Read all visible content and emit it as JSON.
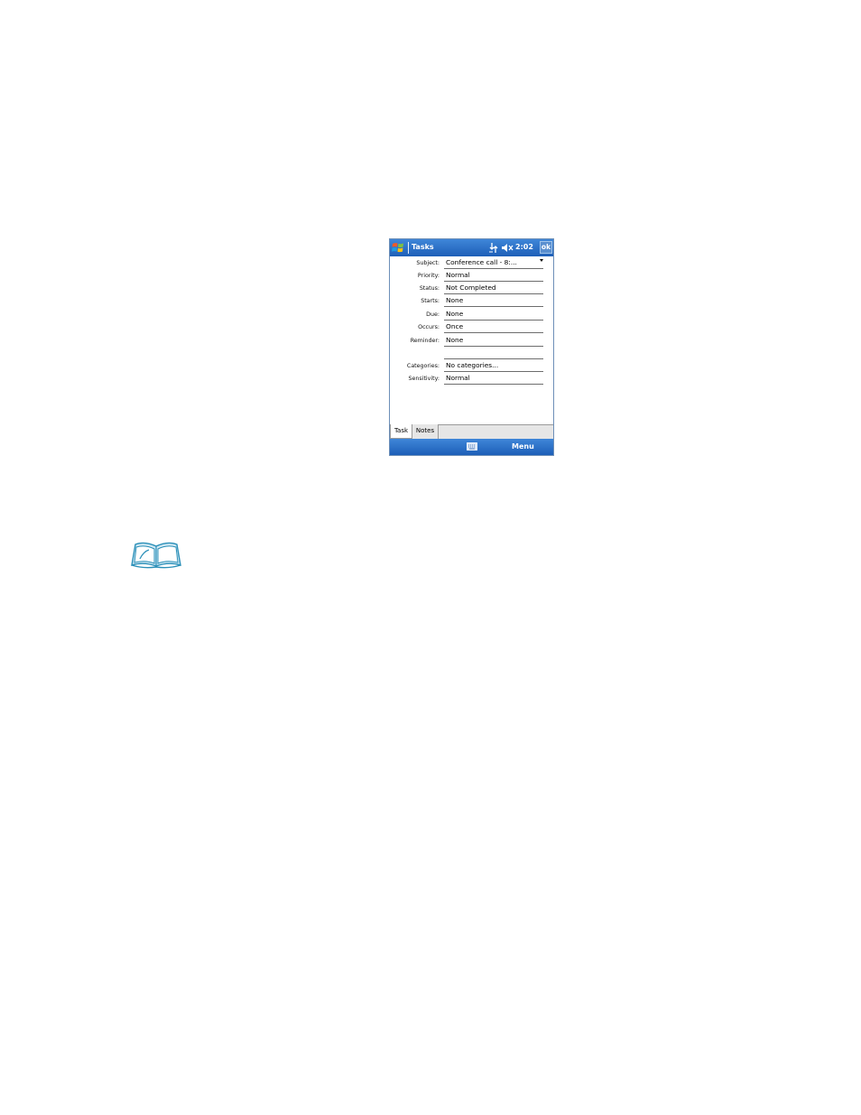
{
  "window": {
    "title": "Tasks",
    "time": "2:02",
    "ok_label": "ok"
  },
  "fields": [
    {
      "label": "Subject:",
      "value": "Conference call - 8:...",
      "has_dropdown": true
    },
    {
      "label": "Priority:",
      "value": "Normal"
    },
    {
      "label": "Status:",
      "value": "Not Completed"
    },
    {
      "label": "Starts:",
      "value": "None"
    },
    {
      "label": "Due:",
      "value": "None"
    },
    {
      "label": "Occurs:",
      "value": "Once"
    },
    {
      "label": "Reminder:",
      "value": "None"
    },
    {
      "label": "Categories:",
      "value": "No categories..."
    },
    {
      "label": "Sensitivity:",
      "value": "Normal"
    }
  ],
  "tabs": [
    {
      "label": "Task",
      "active": true
    },
    {
      "label": "Notes",
      "active": false
    }
  ],
  "menubar": {
    "menu_label": "Menu"
  },
  "icons": {
    "start": "windows-flag-icon",
    "connectivity": "connectivity-icon",
    "volume": "volume-muted-icon",
    "keyboard": "keyboard-icon",
    "note": "open-book-note-icon"
  },
  "colors": {
    "titlebar": "#1d5fb8",
    "menubar": "#1d5fb8",
    "note_icon": "#2a8fb8"
  }
}
